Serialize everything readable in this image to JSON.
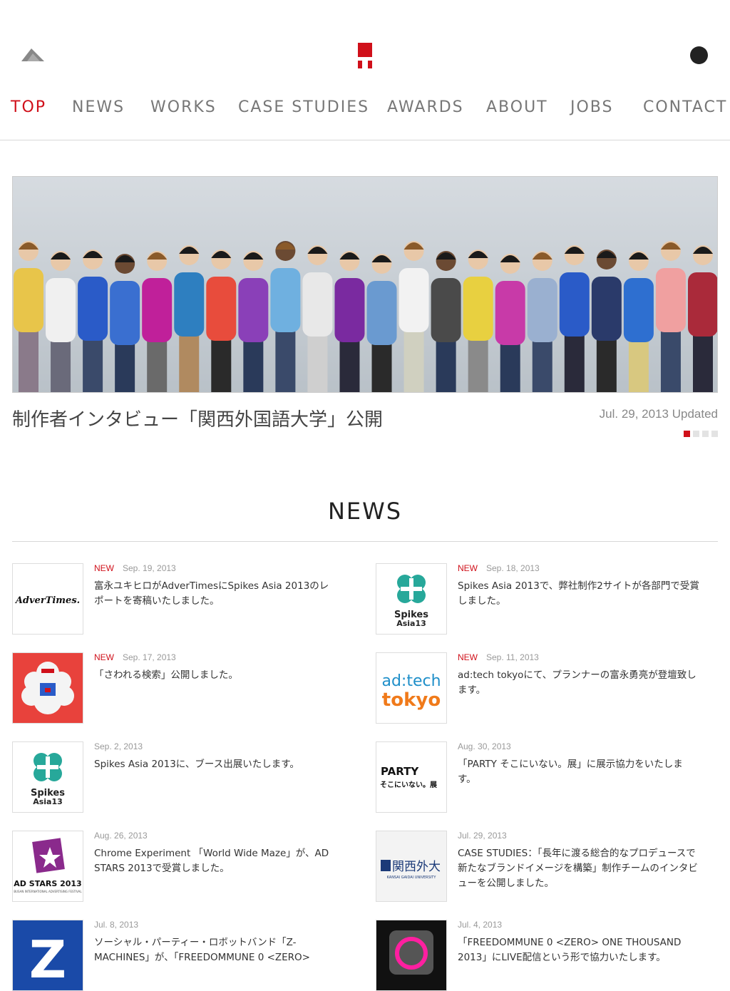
{
  "nav": {
    "items": [
      "TOP",
      "NEWS",
      "WORKS",
      "CASE STUDIES",
      "AWARDS",
      "ABOUT",
      "JOBS",
      "CONTACT"
    ],
    "active": "TOP"
  },
  "hero": {
    "title": "制作者インタビュー「関西外国語大学」公開",
    "date": "Jul. 29, 2013 Updated",
    "slides_total": 4,
    "slide_active": 1
  },
  "news": {
    "heading": "NEWS",
    "new_label": "NEW",
    "items": [
      {
        "is_new": true,
        "date": "Sep. 19, 2013",
        "text": "富永ユキヒロがAdverTimesにSpikes Asia 2013のレポートを寄稿いたしました。",
        "thumb": "advertimes"
      },
      {
        "is_new": true,
        "date": "Sep. 18, 2013",
        "text": "Spikes Asia 2013で、弊社制作2サイトが各部門で受賞しました。",
        "thumb": "spikes-asia"
      },
      {
        "is_new": true,
        "date": "Sep. 17, 2013",
        "text": "「さわれる検索」公開しました。",
        "thumb": "sawareru"
      },
      {
        "is_new": true,
        "date": "Sep. 11, 2013",
        "text": "ad:tech tokyoにて、プランナーの富永勇亮が登壇致します。",
        "thumb": "adtech"
      },
      {
        "is_new": false,
        "date": "Sep. 2, 2013",
        "text": "Spikes Asia 2013に、ブース出展いたします。",
        "thumb": "spikes-asia"
      },
      {
        "is_new": false,
        "date": "Aug. 30, 2013",
        "text": "「PARTY そこにいない。展」に展示協力をいたします。",
        "thumb": "party"
      },
      {
        "is_new": false,
        "date": "Aug. 26, 2013",
        "text": "Chrome Experiment 「World Wide Maze」が、AD STARS 2013で受賞しました。",
        "thumb": "adstars"
      },
      {
        "is_new": false,
        "date": "Jul. 29, 2013",
        "text": "CASE STUDIES：「長年に渡る総合的なプロデュースで新たなブランドイメージを構築」制作チームのインタビューを公開しました。",
        "thumb": "kansai"
      },
      {
        "is_new": false,
        "date": "Jul. 8, 2013",
        "text": "ソーシャル・パーティー・ロボットバンド「Z-MACHINES」が、「FREEDOMMUNE 0 <ZERO>",
        "thumb": "z"
      },
      {
        "is_new": false,
        "date": "Jul. 4, 2013",
        "text": "「FREEDOMMUNE 0 <ZERO> ONE THOUSAND 2013」にLIVE配信という形で協力いたします。",
        "thumb": "freedommune"
      }
    ]
  },
  "thumb_text": {
    "advertimes": "AdverTimes.",
    "spikes_1": "Spikes",
    "spikes_2": "Asia13",
    "adtech_1": "ad:tech",
    "adtech_2": "tokyo",
    "party_1": "PARTY",
    "party_2": "そこにいない。展",
    "adstars": "AD STARS 2013",
    "adstars_sub": "BUSAN INTERNATIONAL ADVERTISING FESTIVAL",
    "kansai_1": "関西外大",
    "kansai_2": "KANSAI GAIDAI UNIVERSITY",
    "z": "Z"
  },
  "colors": {
    "accent": "#d0101a",
    "nav_text": "#777777",
    "spikes_teal": "#27a89a",
    "adtech_blue": "#1f8fc9",
    "adtech_orange": "#f07a1a",
    "adstars_purple": "#8a2a8c",
    "z_blue": "#1a4aa8",
    "red_thumb_bg": "#e8423c"
  }
}
